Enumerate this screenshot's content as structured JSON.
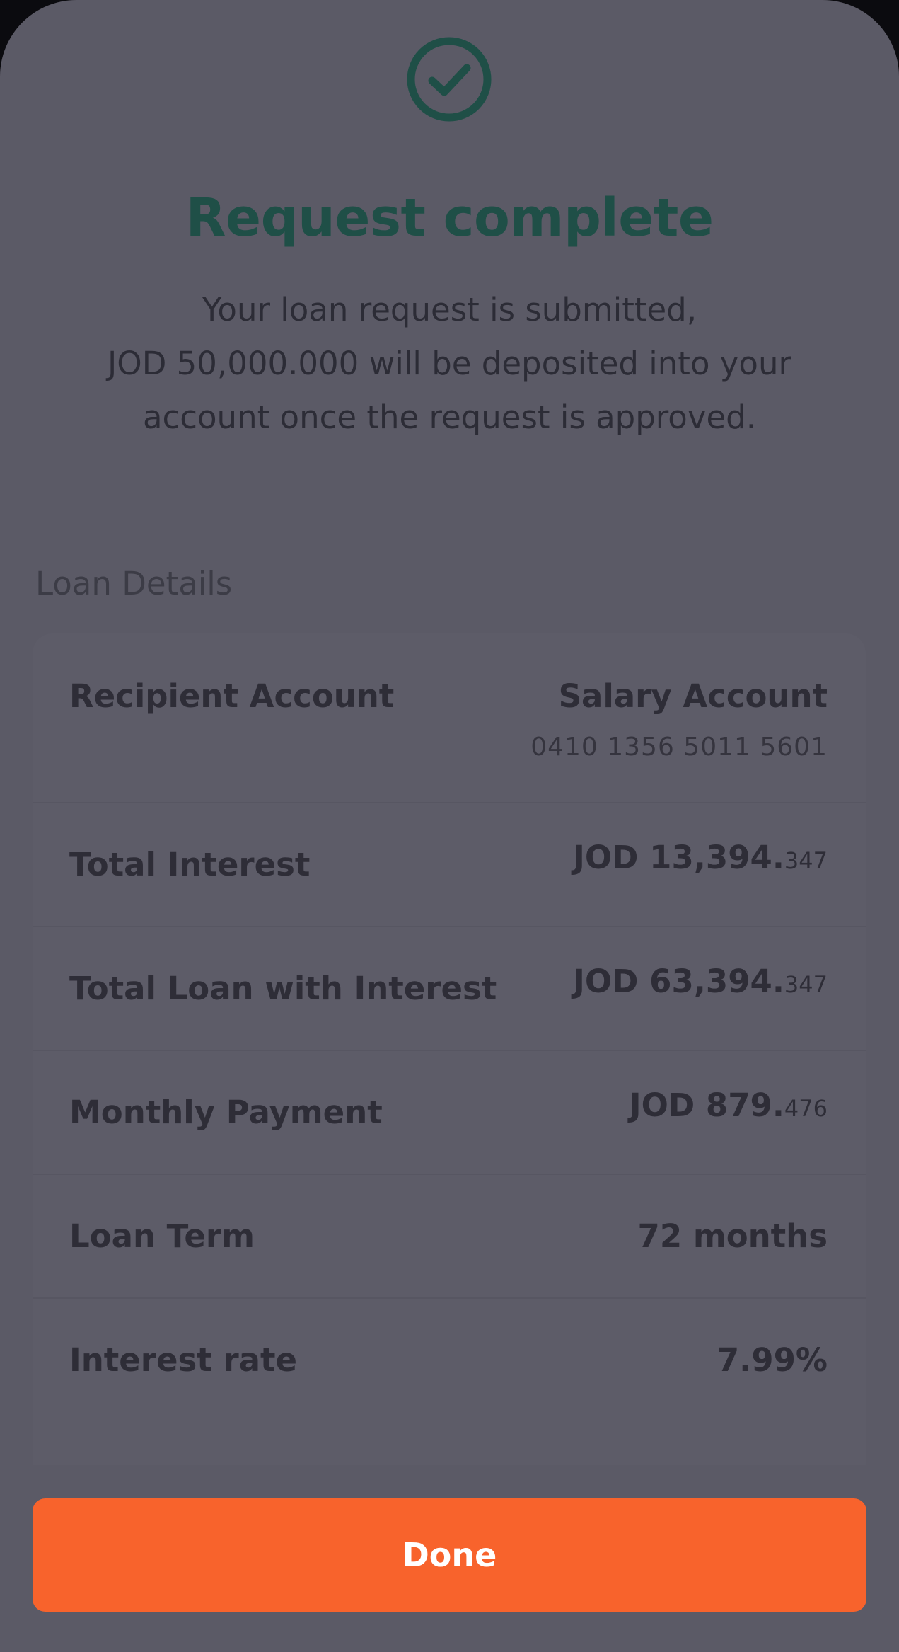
{
  "header": {
    "icon": "check-circle-icon",
    "title": "Request complete",
    "message_lines": [
      "Your loan request is submitted,",
      "JOD 50,000.000 will be deposited into your",
      "account once the request is approved."
    ]
  },
  "loan_details": {
    "section_label": "Loan Details",
    "recipient": {
      "label": "Recipient Account",
      "account_name": "Salary Account",
      "account_number": "0410 1356 5011 5601"
    },
    "rows": [
      {
        "label": "Total Interest",
        "value_main": "JOD 13,394.",
        "value_decimal": "347"
      },
      {
        "label": "Total Loan with Interest",
        "value_main": "JOD 63,394.",
        "value_decimal": "347"
      },
      {
        "label": "Monthly Payment",
        "value_main": "JOD 879.",
        "value_decimal": "476"
      },
      {
        "label": "Loan Term",
        "value_main": "72 months",
        "value_decimal": ""
      },
      {
        "label": "Interest rate",
        "value_main": "7.99%",
        "value_decimal": ""
      }
    ]
  },
  "actions": {
    "done_label": "Done"
  },
  "colors": {
    "accent": "#f8632c",
    "title": "#1f4f47",
    "overlay": "#5b5a66"
  }
}
